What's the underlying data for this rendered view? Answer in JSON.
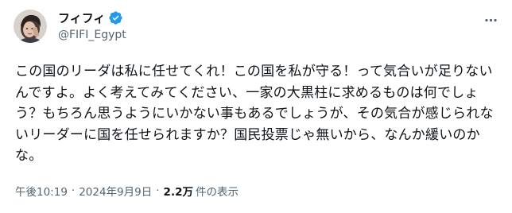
{
  "author": {
    "display_name": "フィフィ",
    "handle": "@FIFI_Egypt",
    "verified_color": "#1d9bf0"
  },
  "icons": {
    "avatar": "profile-photo",
    "verified": "verified-badge-icon",
    "more": "more-options-icon"
  },
  "tweet": {
    "text": "この国のリーダは私に任せてくれ！この国を私が守る！って気合いが足りないんですよ。よく考えてみてください、一家の大黒柱に求めるものは何でしょう？もちろん思うようにいかない事もあるでしょうが、その気合が感じられないリーダーに国を任せられますか？国民投票じゃ無いから、なんか緩いのかな。"
  },
  "meta": {
    "time": "午後10:19",
    "separator": "·",
    "date": "2024年9月9日",
    "views_count": "2.2万",
    "views_label": "件の表示"
  }
}
